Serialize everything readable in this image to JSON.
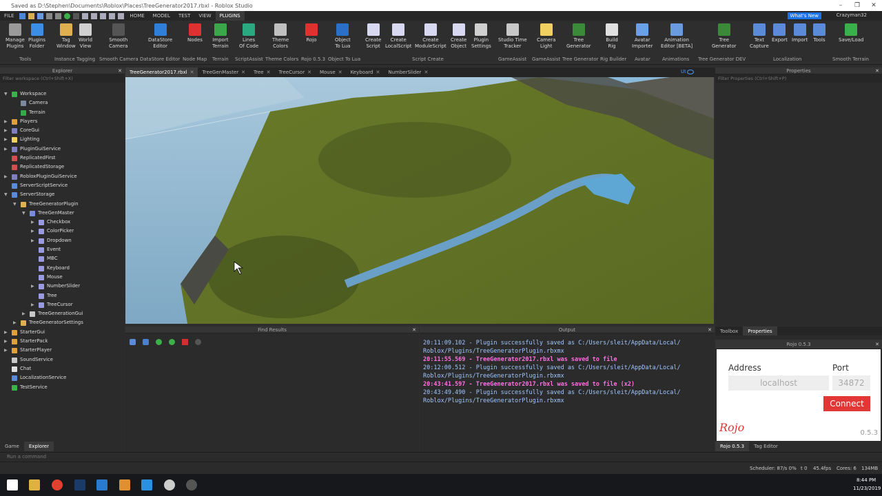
{
  "window": {
    "title": "Saved as D:\\Stephen\\Documents\\Roblox\\Places\\TreeGenerator2017.rbxl - Roblox Studio",
    "controls": [
      "–",
      "❐",
      "✕"
    ]
  },
  "menubar": {
    "items": [
      "FILE",
      "HOME",
      "MODEL",
      "TEST",
      "VIEW",
      "PLUGINS"
    ],
    "active": "PLUGINS",
    "whats_new": "What's New",
    "user": "Crazyman32"
  },
  "ribbon": {
    "buttons": [
      {
        "label": "Manage\nPlugins",
        "icon": "gear-icon",
        "color": "#9a9a9a"
      },
      {
        "label": "Plugins\nFolder",
        "icon": "folder-icon",
        "color": "#3a8ee6"
      },
      {
        "label": "Tag\nWindow",
        "icon": "tag-icon",
        "color": "#e0b050"
      },
      {
        "label": "World\nView",
        "icon": "world-icon",
        "color": "#d0d0d0"
      },
      {
        "label": "Smooth\nCamera",
        "icon": "camera-icon",
        "color": "#555555"
      },
      {
        "label": "DataStore\nEditor",
        "icon": "datastore-icon",
        "color": "#2f7ed8"
      },
      {
        "label": "Nodes",
        "icon": "nodes-icon",
        "color": "#e03030"
      },
      {
        "label": "Import\nTerrain",
        "icon": "terrain-icon",
        "color": "#3aa84a"
      },
      {
        "label": "Lines\nOf Code",
        "icon": "loc-icon",
        "color": "#2aa880"
      },
      {
        "label": "Theme\nColors",
        "icon": "theme-icon",
        "color": "#c0c0c0"
      },
      {
        "label": "Rojo",
        "icon": "rojo-icon",
        "color": "#e03030"
      },
      {
        "label": "Object\nTo Lua",
        "icon": "lua-icon",
        "color": "#2a6fc8"
      },
      {
        "label": "Create\nScript",
        "icon": "script-icon",
        "color": "#d8d8f0"
      },
      {
        "label": "Create\nLocalScript",
        "icon": "localscript-icon",
        "color": "#d8d8f0"
      },
      {
        "label": "Create\nModuleScript",
        "icon": "modulescript-icon",
        "color": "#d8d8f0"
      },
      {
        "label": "Create\nObject",
        "icon": "object-icon",
        "color": "#d8d8f0"
      },
      {
        "label": "Plugin\nSettings",
        "icon": "settings-icon",
        "color": "#d0d0d0"
      },
      {
        "label": "Studio Time\nTracker",
        "icon": "clock-icon",
        "color": "#c8c8c8"
      },
      {
        "label": "Camera\nLight",
        "icon": "bulb-icon",
        "color": "#f0d060"
      },
      {
        "label": "Tree\nGenerator",
        "icon": "tree-icon",
        "color": "#3a8a3a"
      },
      {
        "label": "Build\nRig",
        "icon": "rig-icon",
        "color": "#e0e0e0"
      },
      {
        "label": "Avatar\nImporter",
        "icon": "avatar-icon",
        "color": "#6aa0e8"
      },
      {
        "label": "Animation\nEditor [BETA]",
        "icon": "animation-icon",
        "color": "#6a9ae0"
      },
      {
        "label": "Tree\nGenerator",
        "icon": "tree-dev-icon",
        "color": "#3a8a3a"
      },
      {
        "label": "Text\nCapture",
        "icon": "text-capture-icon",
        "color": "#5a8ad8"
      },
      {
        "label": "Export",
        "icon": "export-icon",
        "color": "#5a8ad8"
      },
      {
        "label": "Import",
        "icon": "import-icon",
        "color": "#5a8ad8"
      },
      {
        "label": "Tools",
        "icon": "globe-icon",
        "color": "#5a8ad8"
      },
      {
        "label": "Save/Load",
        "icon": "save-load-icon",
        "color": "#3ab04a"
      }
    ],
    "groups": [
      "Tools",
      "Instance Tagging",
      "Smooth Camera",
      "DataStore Editor",
      "Node Map",
      "Terrain",
      "ScriptAssist",
      "Theme Colors",
      "Rojo 0.5.3",
      "Object To Lua",
      "Script Create",
      "GameAssist",
      "GameAssist",
      "Tree Generator",
      "Rig Builder",
      "Avatar",
      "Animations",
      "Tree Generator DEV",
      "Localization",
      "Smooth Terrain"
    ]
  },
  "explorer": {
    "title": "Explorer",
    "filter_placeholder": "Filter workspace (Ctrl+Shift+X)",
    "items": [
      {
        "label": "Workspace",
        "depth": 0,
        "arrow": "▼",
        "color": "#3cb04a"
      },
      {
        "label": "Camera",
        "depth": 1,
        "arrow": "",
        "color": "#7a8aa0"
      },
      {
        "label": "Terrain",
        "depth": 1,
        "arrow": "",
        "color": "#3aa84a"
      },
      {
        "label": "Players",
        "depth": 0,
        "arrow": "▶",
        "color": "#e0a040"
      },
      {
        "label": "CoreGui",
        "depth": 0,
        "arrow": "▶",
        "color": "#8080c0"
      },
      {
        "label": "Lighting",
        "depth": 0,
        "arrow": "▶",
        "color": "#f0d060"
      },
      {
        "label": "PluginGuiService",
        "depth": 0,
        "arrow": "▶",
        "color": "#8080c0"
      },
      {
        "label": "ReplicatedFirst",
        "depth": 0,
        "arrow": "",
        "color": "#d05050"
      },
      {
        "label": "ReplicatedStorage",
        "depth": 0,
        "arrow": "",
        "color": "#d05050"
      },
      {
        "label": "RobloxPluginGuiService",
        "depth": 0,
        "arrow": "▶",
        "color": "#8080c0"
      },
      {
        "label": "ServerScriptService",
        "depth": 0,
        "arrow": "",
        "color": "#5a8ad8"
      },
      {
        "label": "ServerStorage",
        "depth": 0,
        "arrow": "▼",
        "color": "#5a8ad8"
      },
      {
        "label": "TreeGeneratorPlugin",
        "depth": 1,
        "arrow": "▼",
        "color": "#e0b050"
      },
      {
        "label": "TreeGenMaster",
        "depth": 2,
        "arrow": "▼",
        "color": "#7a8ae0"
      },
      {
        "label": "Checkbox",
        "depth": 3,
        "arrow": "▶",
        "color": "#9a9ae0"
      },
      {
        "label": "ColorPicker",
        "depth": 3,
        "arrow": "▶",
        "color": "#9a9ae0"
      },
      {
        "label": "Dropdown",
        "depth": 3,
        "arrow": "▶",
        "color": "#9a9ae0"
      },
      {
        "label": "Event",
        "depth": 3,
        "arrow": "",
        "color": "#9a9ae0"
      },
      {
        "label": "MBC",
        "depth": 3,
        "arrow": "",
        "color": "#9a9ae0"
      },
      {
        "label": "Keyboard",
        "depth": 3,
        "arrow": "",
        "color": "#9a9ae0"
      },
      {
        "label": "Mouse",
        "depth": 3,
        "arrow": "",
        "color": "#9a9ae0"
      },
      {
        "label": "NumberSlider",
        "depth": 3,
        "arrow": "▶",
        "color": "#9a9ae0"
      },
      {
        "label": "Tree",
        "depth": 3,
        "arrow": "",
        "color": "#9a9ae0"
      },
      {
        "label": "TreeCursor",
        "depth": 3,
        "arrow": "▶",
        "color": "#9a9ae0"
      },
      {
        "label": "TreeGenerationGui",
        "depth": 2,
        "arrow": "▶",
        "color": "#c8c8c8"
      },
      {
        "label": "TreeGeneratorSettings",
        "depth": 1,
        "arrow": "▶",
        "color": "#e0b050"
      },
      {
        "label": "StarterGui",
        "depth": 0,
        "arrow": "▶",
        "color": "#e0a040"
      },
      {
        "label": "StarterPack",
        "depth": 0,
        "arrow": "▶",
        "color": "#e0a040"
      },
      {
        "label": "StarterPlayer",
        "depth": 0,
        "arrow": "▶",
        "color": "#e0a040"
      },
      {
        "label": "SoundService",
        "depth": 0,
        "arrow": "",
        "color": "#c8c8c8"
      },
      {
        "label": "Chat",
        "depth": 0,
        "arrow": "",
        "color": "#e0e0e0"
      },
      {
        "label": "LocalizationService",
        "depth": 0,
        "arrow": "",
        "color": "#5a8ad8"
      },
      {
        "label": "TestService",
        "depth": 0,
        "arrow": "",
        "color": "#3cb04a"
      }
    ],
    "bottom_tabs": [
      "Game",
      "Explorer"
    ],
    "active_tab": "Explorer"
  },
  "doc_tabs": {
    "items": [
      "TreeGenerator2017.rbxl",
      "TreeGenMaster",
      "Tree",
      "TreeCursor",
      "Mouse",
      "Keyboard",
      "NumberSlider"
    ],
    "active": "TreeGenerator2017.rbxl",
    "ui_toggle": "UI"
  },
  "properties": {
    "title": "Properties",
    "filter_placeholder": "Filter Properties (Ctrl+Shift+P)"
  },
  "find_results": {
    "title": "Find Results"
  },
  "output": {
    "title": "Output",
    "lines": [
      {
        "text": "20:11:09.102 - Plugin successfully saved as C:/Users/sleit/AppData/Local/",
        "hl": false
      },
      {
        "text": "Roblox/Plugins/TreeGeneratorPlugin.rbxmx",
        "hl": false
      },
      {
        "text": "20:11:55.569 - TreeGenerator2017.rbxl was saved to file",
        "hl": true
      },
      {
        "text": "20:12:00.512 - Plugin successfully saved as C:/Users/sleit/AppData/Local/",
        "hl": false
      },
      {
        "text": "Roblox/Plugins/TreeGeneratorPlugin.rbxmx",
        "hl": false
      },
      {
        "text": "20:43:41.597 - TreeGenerator2017.rbxl was saved to file (x2)",
        "hl": true
      },
      {
        "text": "20:43:49.490 - Plugin successfully saved as C:/Users/sleit/AppData/Local/",
        "hl": false
      },
      {
        "text": "Roblox/Plugins/TreeGeneratorPlugin.rbxmx",
        "hl": false
      }
    ]
  },
  "toolbox_tabs": {
    "items": [
      "Toolbox",
      "Properties"
    ],
    "active": "Properties",
    "bottom_items": [
      "Rojo 0.5.3",
      "Tag Editor"
    ],
    "bottom_active": "Rojo 0.5.3"
  },
  "rojo": {
    "title": "Rojo 0.5.3",
    "address_label": "Address",
    "port_label": "Port",
    "address_placeholder": "localhost",
    "port_placeholder": "34872",
    "connect_label": "Connect",
    "logo": "Rojo",
    "version": "0.5.3",
    "accent": "#e13835"
  },
  "command_bar": {
    "placeholder": "Run a command"
  },
  "status_bar": {
    "scheduler": "Scheduler: 87/s 0%",
    "t": "t 0",
    "fps": "45.4fps",
    "cores": "Cores: 6",
    "memory": "134MB"
  },
  "taskbar": {
    "time": "8:44 PM",
    "date": "11/23/2019"
  }
}
